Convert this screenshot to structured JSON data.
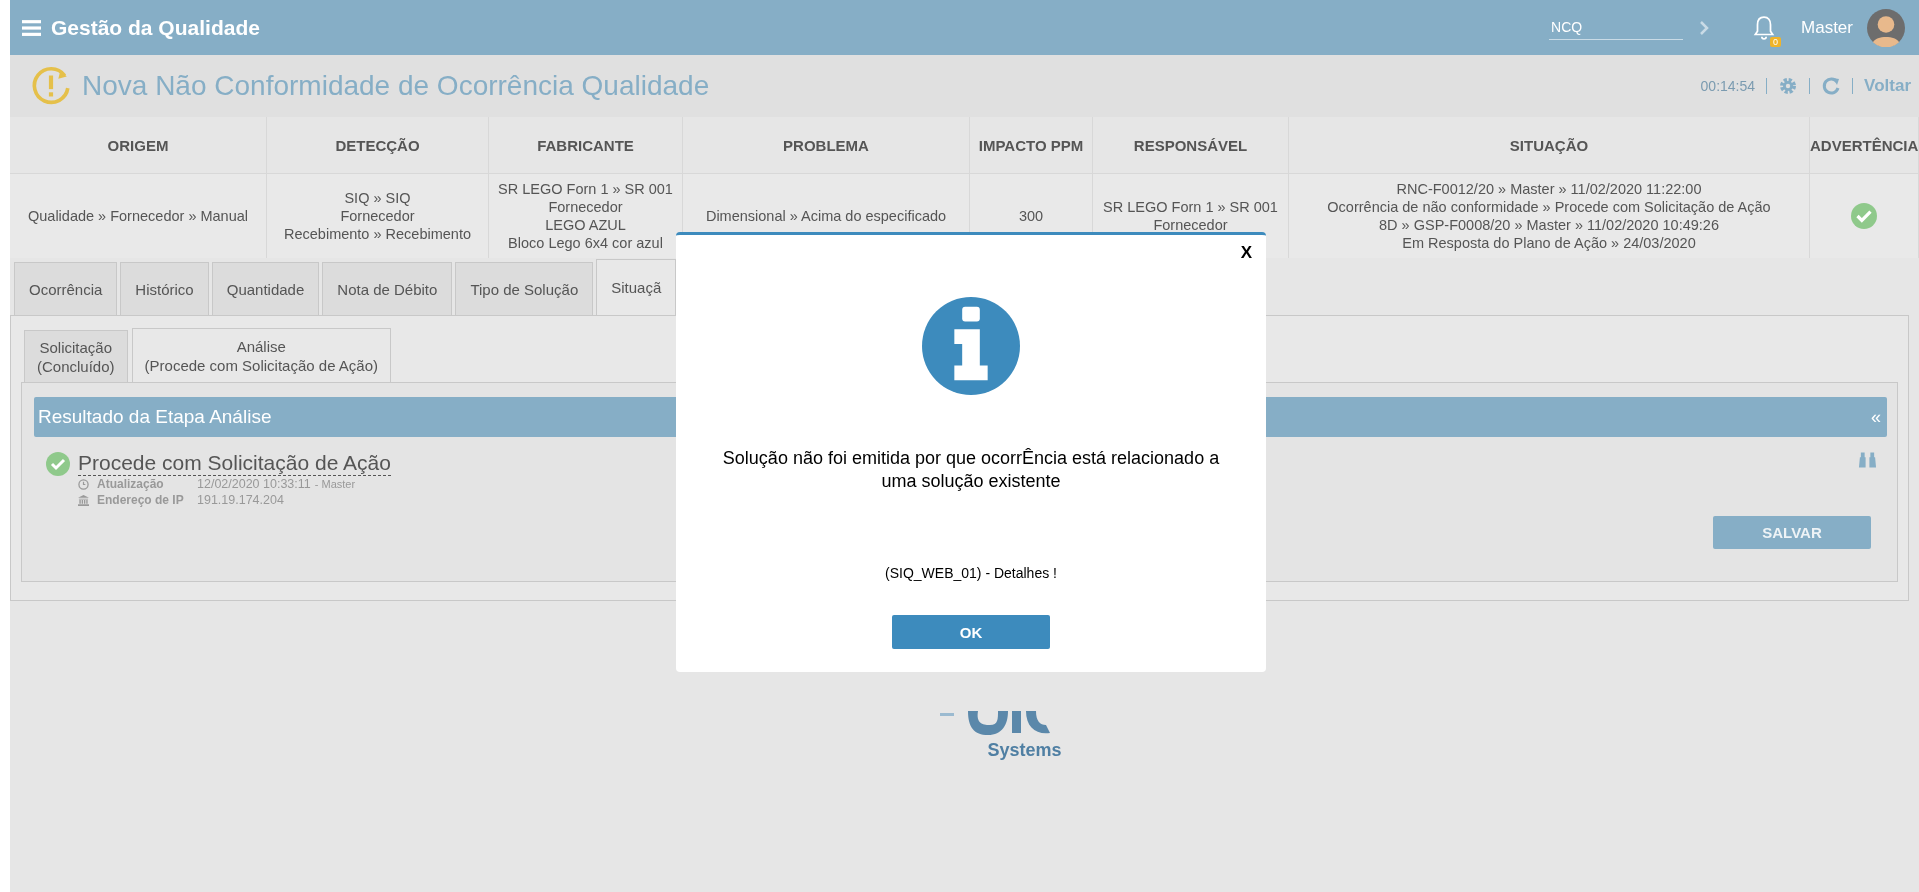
{
  "app": {
    "title": "Gestão da Qualidade",
    "search": {
      "value": "NCQ"
    },
    "notifications": "0",
    "user": "Master"
  },
  "page": {
    "title": "Nova Não Conformidade de Ocorrência Qualidade",
    "timer": "00:14:54",
    "back": "Voltar"
  },
  "table": {
    "columns": [
      "ORIGEM",
      "DETECÇÃO",
      "FABRICANTE",
      "PROBLEMA",
      "IMPACTO PPM",
      "RESPONSÁVEL",
      "SITUAÇÃO",
      "ADVERTÊNCIA"
    ],
    "rows": [
      {
        "cells": [
          [
            "Qualidade » Fornecedor » Manual"
          ],
          [
            "SIQ » SIQ",
            "Fornecedor",
            "Recebimento » Recebimento"
          ],
          [
            "SR LEGO Forn 1 » SR 001",
            "Fornecedor",
            "LEGO AZUL",
            "Bloco Lego 6x4 cor azul"
          ],
          [
            "Dimensional » Acima do especificado"
          ],
          [
            "300"
          ],
          [
            "SR LEGO Forn 1 » SR 001",
            "Fornecedor"
          ],
          [
            "RNC-F0012/20 » Master » 11/02/2020 11:22:00",
            "Ocorrência de não conformidade » Procede com Solicitação de Ação",
            "8D » GSP-F0008/20 » Master » 11/02/2020 10:49:26",
            "Em Resposta do Plano de Ação » 24/03/2020"
          ]
        ],
        "warning_ok": true
      }
    ]
  },
  "tabs": [
    {
      "label": "Ocorrência",
      "selected": false
    },
    {
      "label": "Histórico",
      "selected": false
    },
    {
      "label": "Quantidade",
      "selected": false
    },
    {
      "label": "Nota de Débito",
      "selected": false
    },
    {
      "label": "Tipo de Solução",
      "selected": false
    },
    {
      "label": "Situaçã",
      "selected": true
    }
  ],
  "subtabs": [
    {
      "lines": [
        "Solicitação",
        "(Concluído)"
      ],
      "selected": false
    },
    {
      "lines": [
        "Análise",
        "(Procede com Solicitação de Ação)"
      ],
      "selected": true
    }
  ],
  "section": {
    "title": "Resultado da Etapa Análise",
    "collapse": "«",
    "result": "Procede com Solicitação de Ação",
    "approved": true,
    "meta": [
      {
        "kind": "clock",
        "label": "Atualização",
        "value": "12/02/2020 10:33:11",
        "extra": "- Master"
      },
      {
        "kind": "bank",
        "label": "Endereço de IP",
        "value": "191.19.174.204"
      }
    ],
    "save": "SALVAR"
  },
  "logo": {
    "name": "Systems"
  },
  "dialog": {
    "close": "X",
    "message": "Solução não foi emitida por que ocorrÊncia está relacionado a uma solução existente",
    "detail": "(SIQ_WEB_01) - Detalhes !",
    "ok": "OK"
  }
}
